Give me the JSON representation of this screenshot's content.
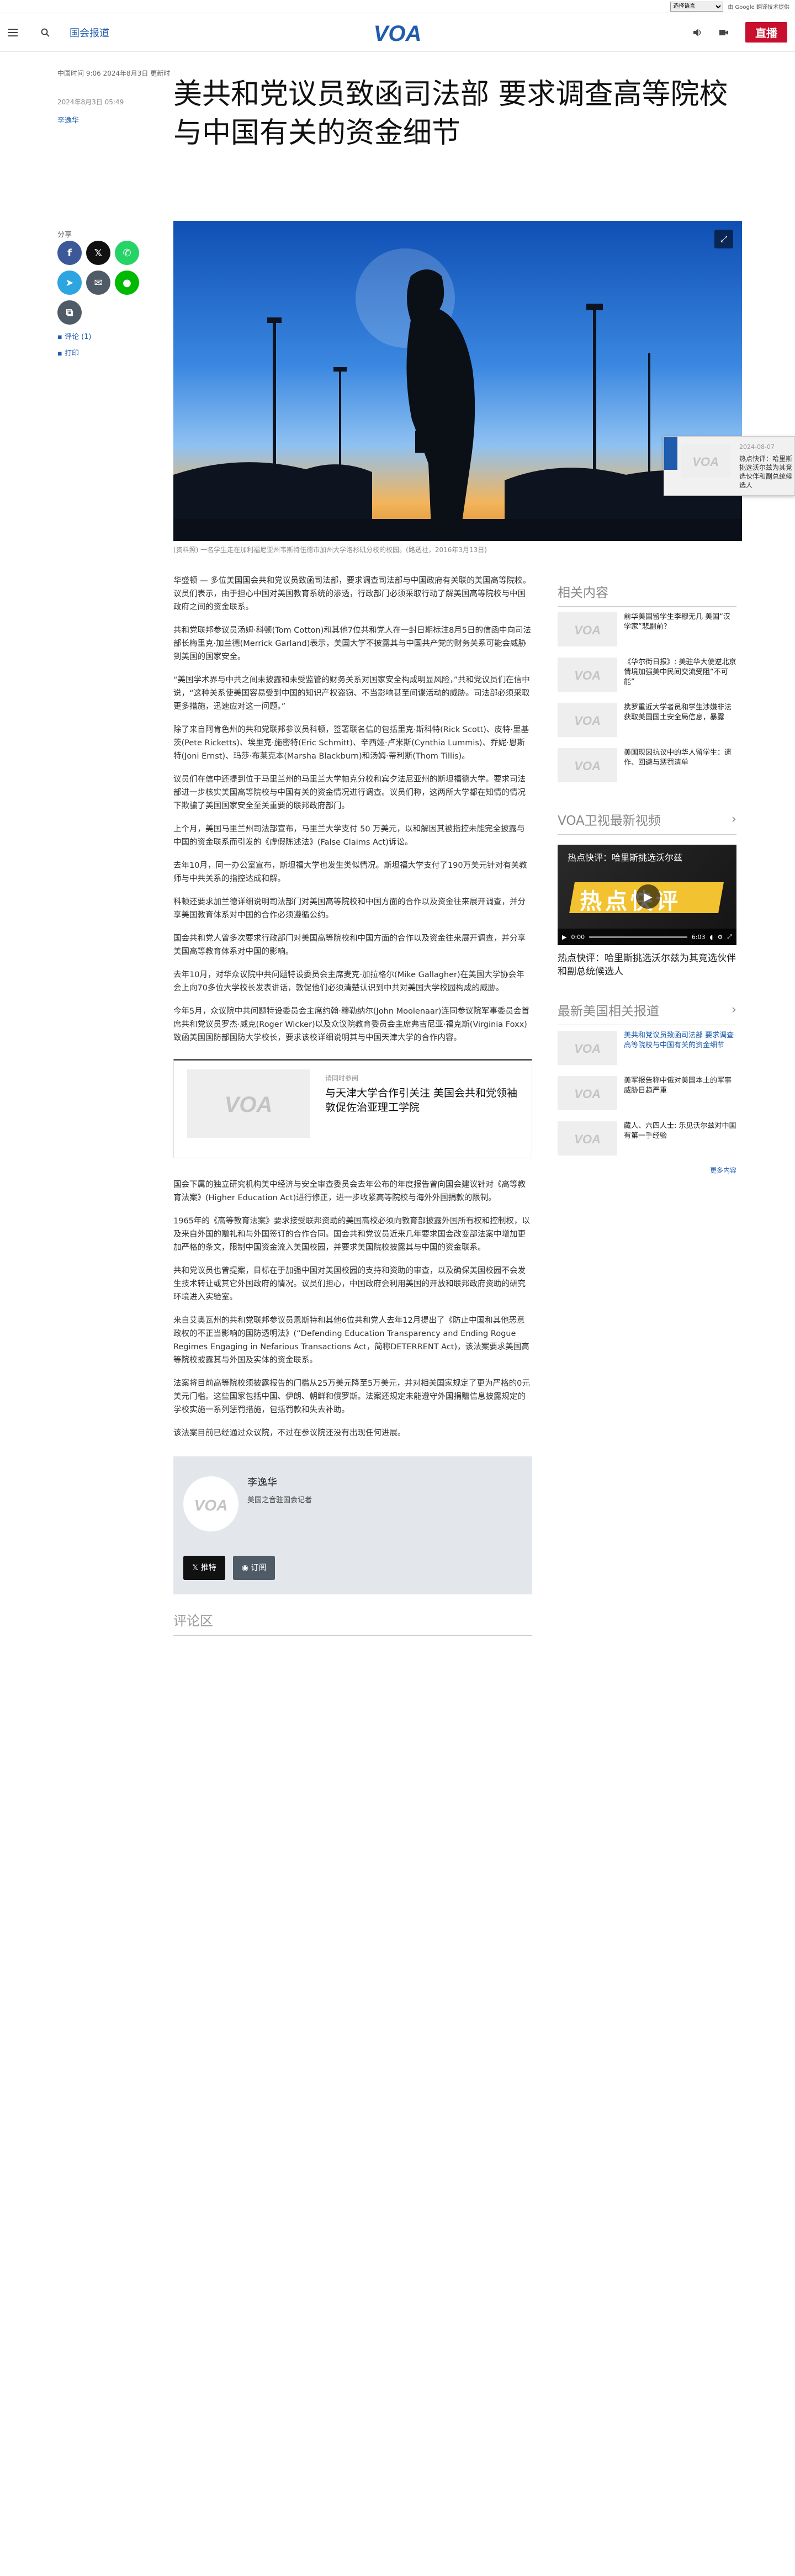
{
  "topbar": {
    "language_select": "选择语言",
    "google_label": "由 Google 翻译技术提供"
  },
  "header": {
    "section": "国会报道",
    "live": "直播"
  },
  "article": {
    "dateline": "中国时间 9:06 2024年8月3日 更新时",
    "published": "2024年8月3日 05:49",
    "author": "李逸华",
    "title": "美共和党议员致函司法部 要求调查高等院校与中国有关的资金细节",
    "share_label": "分享",
    "comments_link": "评论 (1)",
    "print_link": "打印",
    "caption": "(资料照) 一名学生走在加利福尼亚州韦斯特伍德市加州大学洛杉矶分校的校园。(路透社，2016年3月13日)",
    "paragraphs": [
      "华盛顿 — 多位美国国会共和党议员致函司法部，要求调查司法部与中国政府有关联的美国高等院校。议员们表示，由于担心中国对美国教育系统的渗透，行政部门必须采取行动了解美国高等院校与中国政府之间的资金联系。",
      "共和党联邦参议员汤姆·科顿(Tom Cotton)和其他7位共和党人在一封日期标注8月5日的信函中向司法部长梅里克·加兰德(Merrick Garland)表示，美国大学不披露其与中国共产党的财务关系可能会威胁到美国的国家安全。",
      "“美国学术界与中共之间未披露和未受监管的财务关系对国家安全构成明显风险，”共和党议员们在信中说，“这种关系使美国容易受到中国的知识产权盗窃、不当影响甚至间谍活动的威胁。司法部必须采取更多措施，迅速应对这一问题。”",
      "除了来自阿肯色州的共和党联邦参议员科顿，签署联名信的包括里克·斯科特(Rick Scott)、皮特·里基茨(Pete Ricketts)、埃里克·施密特(Eric Schmitt)、辛西娅·卢米斯(Cynthia Lummis)、乔妮·恩斯特(Joni Ernst)、玛莎·布莱克本(Marsha Blackburn)和汤姆·蒂利斯(Thom Tillis)。",
      "议员们在信中还提到位于马里兰州的马里兰大学帕克分校和宾夕法尼亚州的斯坦福德大学。要求司法部进一步核实美国高等院校与中国有关的资金情况进行调查。议员们称，这两所大学都在知情的情况下欺骗了美国国家安全至关重要的联邦政府部门。",
      "上个月，美国马里兰州司法部宣布，马里兰大学支付 50 万美元，以和解因其被指控未能完全披露与中国的资金联系而引发的《虚假陈述法》(False Claims Act)诉讼。",
      "去年10月，同一办公室宣布，斯坦福大学也发生类似情况。斯坦福大学支付了190万美元针对有关教师与中共关系的指控达成和解。",
      "科顿还要求加兰德详细说明司法部门对美国高等院校和中国方面的合作以及资金往来展开调查，并分享美国教育体系对中国的合作必须遵循公约。",
      "国会共和党人曾多次要求行政部门对美国高等院校和中国方面的合作以及资金往来展开调查，并分享美国高等教育体系对中国的影响。",
      "去年10月，对华众议院中共问题特设委员会主席麦克·加拉格尔(Mike Gallagher)在美国大学协会年会上向70多位大学校长发表讲话，敦促他们必须清楚认识到中共对美国大学校园构成的威胁。",
      "今年5月，众议院中共问题特设委员会主席约翰·穆勒纳尔(John Moolenaar)连同参议院军事委员会首席共和党议员罗杰·威克(Roger Wicker)以及众议院教育委员会主席弗吉尼亚·福克斯(Virginia Foxx)致函美国国防部国防大学校长，要求该校详细说明其与中国天津大学的合作内容。"
    ],
    "related": {
      "kicker": "请同时参阅",
      "title": "与天津大学合作引关注 美国会共和党领袖敦促佐治亚理工学院"
    },
    "paragraphs2": [
      "国会下属的独立研究机构美中经济与安全审查委员会去年公布的年度报告曾向国会建议针对《高等教育法案》(Higher Education Act)进行修正，进一步收紧高等院校与海外外国捐款的限制。",
      "1965年的《高等教育法案》要求接受联邦资助的美国高校必须向教育部披露外国所有权和控制权，以及来自外国的赠礼和与外国签订的合作合同。国会共和党议员近来几年要求国会改变部法案中增加更加严格的条文，限制中国资金流入美国校园，并要求美国院校披露其与中国的资金联系。",
      "共和党议员也曾提案，目标在于加强中国对美国校园的支持和资助的审查，以及确保美国校园不会发生技术转让或其它外国政府的情况。议员们担心，中国政府会利用美国的开放和联邦政府资助的研究环境进入实验室。",
      "来自艾奥瓦州的共和党联邦参议员恩斯特和其他6位共和党人去年12月提出了《防止中国和其他恶意政权的不正当影响的国防透明法》(“Defending Education Transparency and Ending Rogue Regimes Engaging in Nefarious Transactions Act，简称DETERRENT Act)，该法案要求美国高等院校披露其与外国及实体的资金联系。",
      "法案将目前高等院校须披露报告的门槛从25万美元降至5万美元，并对相关国家规定了更为严格的0元美元门槛。这些国家包括中国、伊朗、朝鲜和俄罗斯。法案还规定未能遵守外国捐赠信息披露规定的学校实施一系列惩罚措施，包括罚款和失去补助。",
      "该法案目前已经通过众议院，不过在参议院还没有出现任何进展。"
    ],
    "author_box": {
      "name": "李逸华",
      "role": "美国之音驻国会记者",
      "x_button": "推特",
      "rss_button": "订阅"
    },
    "comments_header": "评论区"
  },
  "sidebar": {
    "related_title": "相关内容",
    "related_items": [
      "前华美国留学生李穆无几 美国“汉学家”悲剧前？",
      "《华尔街日报》: 美驻华大使逆北京情境加强美中民间交流受阻“不可能”",
      "携罗重近大学者员和学生涉嫌非法获取美国国土安全局信息，暴露",
      "美国现因抗议中的华人留学生：遗作、回避与惩罚清单"
    ],
    "video_title": "VOA卫视最新视频",
    "video_overlay": "热点快评：哈里斯挑选沃尔兹",
    "video_big": "热点快评",
    "video_time": "0:00",
    "video_duration": "6:03",
    "video_caption": "热点快评：哈里斯挑选沃尔兹为其竞选伙伴和副总统候选人",
    "latest_title": "最新美国相关报道",
    "latest_items": [
      "美共和党议员致函司法部 要求调查高等院校与中国有关的资金细节",
      "美军报告称中俄对美国本土的军事威胁日趋严重",
      "藏人、六四人士: 乐见沃尔兹对中国有第一手经验"
    ],
    "more": "更多内容"
  },
  "float_tab": {
    "date": "2024-08-07",
    "title": "热点快评：哈里斯挑选沃尔兹为其竞选伙伴和副总统候选人"
  },
  "colors": {
    "brand_blue": "#1f5cad",
    "live_red": "#c8102e",
    "x_black": "#111111",
    "whatsapp": "#25d366",
    "telegram": "#2ca5e0",
    "line": "#00b900",
    "email": "#4f5b67"
  }
}
